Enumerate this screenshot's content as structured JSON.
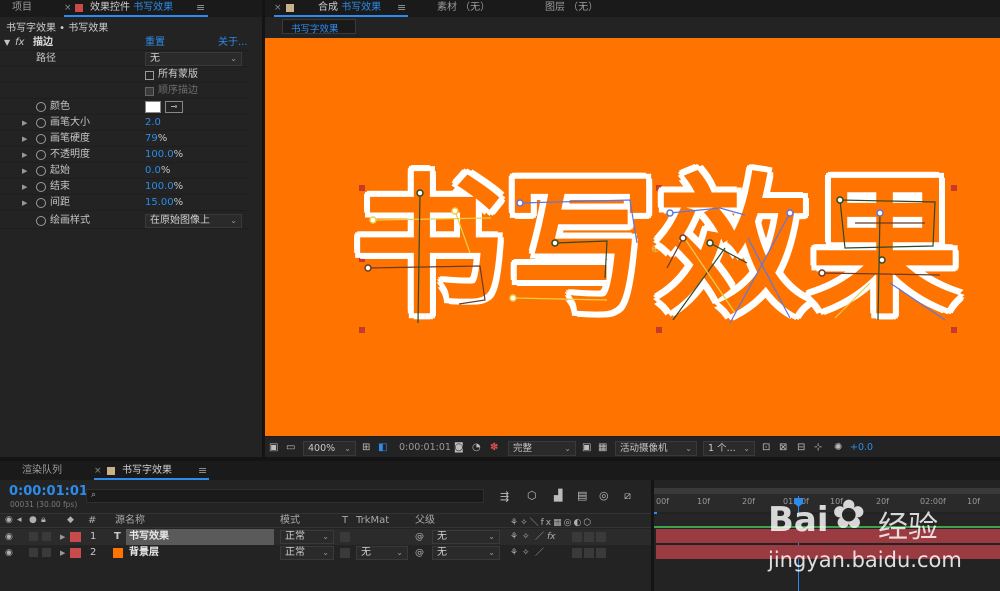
{
  "panels": {
    "project_tab": "项目",
    "effect_controls_tab": "效果控件",
    "effect_controls_layer": "书写效果",
    "comp_tab": "合成",
    "comp_name": "书写效果",
    "footage_tab": "素材 （无）",
    "layer_tab": "图层 （无）",
    "comp_subtab": "书写字效果",
    "breadcrumb": "书写字效果 • 书写效果"
  },
  "effect": {
    "fx": "fx",
    "name": "描边",
    "reset": "重置",
    "about": "关于...",
    "path_label": "路径",
    "path_value": "无",
    "all_masks": "所有蒙版",
    "sequential": "顺序描边",
    "color_label": "颜色",
    "color_value": "#ffffff",
    "params": [
      {
        "label": "画笔大小",
        "value": "2.0",
        "unit": ""
      },
      {
        "label": "画笔硬度",
        "value": "79",
        "unit": "%"
      },
      {
        "label": "不透明度",
        "value": "100.0",
        "unit": "%"
      },
      {
        "label": "起始",
        "value": "0.0",
        "unit": "%"
      },
      {
        "label": "结束",
        "value": "100.0",
        "unit": "%"
      },
      {
        "label": "间距",
        "value": "15.00",
        "unit": "%"
      }
    ],
    "paint_style_label": "绘画样式",
    "paint_style_value": "在原始图像上"
  },
  "canvas": {
    "background": "#ff7400",
    "text": "书写效果"
  },
  "comp_toolbar": {
    "zoom": "400%",
    "timecode": "0:00:01:01",
    "resolution": "完整",
    "camera": "活动摄像机",
    "views": "1 个...",
    "exposure": "+0.0"
  },
  "timeline": {
    "render_queue_tab": "渲染队列",
    "comp_tab": "书写字效果",
    "timecode": "0:00:01:01",
    "fps_info": "00031 (30.00 fps)",
    "search_placeholder": "",
    "columns": {
      "num": "#",
      "source_name": "源名称",
      "mode": "模式",
      "t": "T",
      "trkmat": "TrkMat",
      "parent": "父级"
    },
    "layers": [
      {
        "num": "1",
        "type": "T",
        "name": "书写效果",
        "mode": "正常",
        "trkmat": "",
        "parent": "无",
        "color": "#c94a4a"
      },
      {
        "num": "2",
        "type": "",
        "name": "背景层",
        "mode": "正常",
        "trkmat": "无",
        "parent": "无",
        "color": "#c94a4a"
      }
    ],
    "ruler": [
      "00f",
      "10f",
      "20f",
      "01:00f",
      "10f",
      "20f",
      "02:00f",
      "10f"
    ]
  },
  "watermark": {
    "brand": "Bai",
    "brand2": "经验",
    "url": "jingyan.baidu.com"
  }
}
